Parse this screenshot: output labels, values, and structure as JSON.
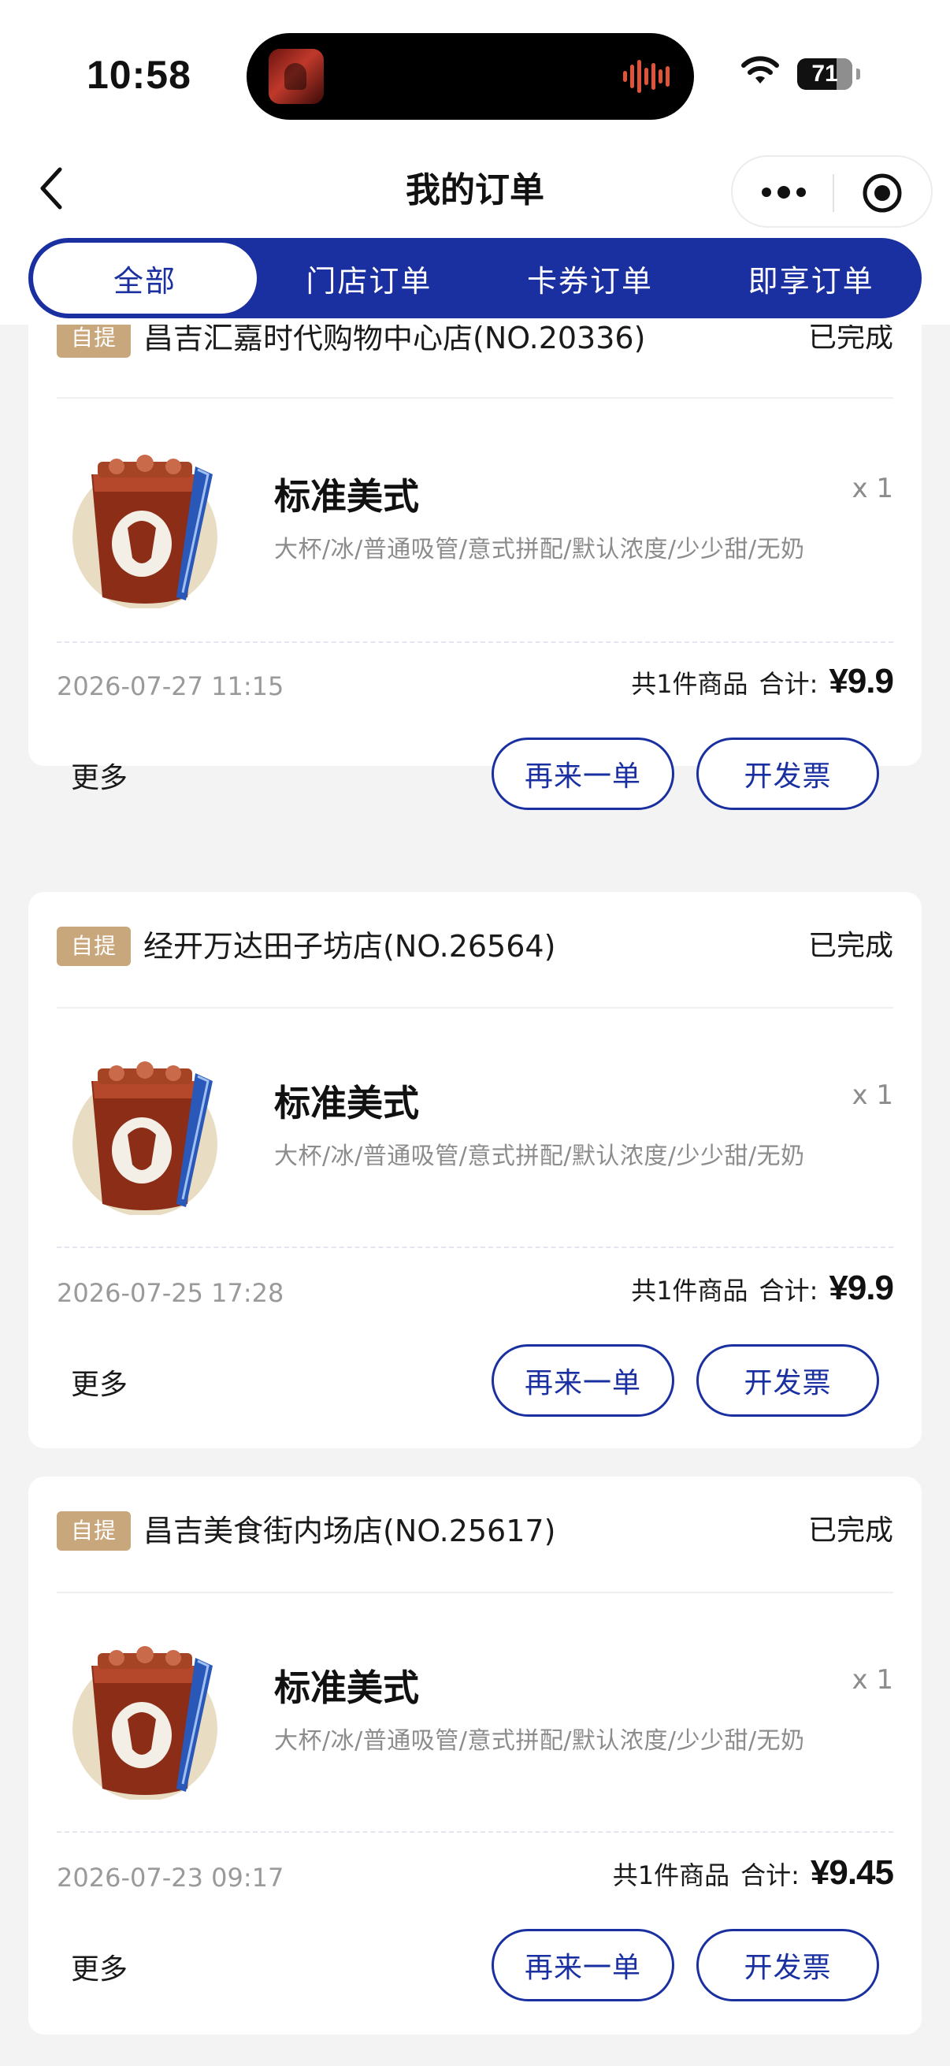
{
  "status_bar": {
    "time": "10:58",
    "battery": "71"
  },
  "nav": {
    "title": "我的订单"
  },
  "tabs": [
    {
      "label": "全部",
      "active": true
    },
    {
      "label": "门店订单",
      "active": false
    },
    {
      "label": "卡券订单",
      "active": false
    },
    {
      "label": "即享订单",
      "active": false
    }
  ],
  "orders": [
    {
      "tag": "自提",
      "store": "昌吉汇嘉时代购物中心店(NO.20336)",
      "status": "已完成",
      "product": {
        "name": "标准美式",
        "spec": "大杯/冰/普通吸管/意式拼配/默认浓度/少少甜/无奶",
        "qty": "x 1"
      },
      "time": "2026-07-27 11:15",
      "count_text": "共1件商品",
      "total_label": "合计:",
      "total": "¥9.9",
      "more": "更多",
      "reorder": "再来一单",
      "invoice": "开发票"
    },
    {
      "tag": "自提",
      "store": "经开万达田子坊店(NO.26564)",
      "status": "已完成",
      "product": {
        "name": "标准美式",
        "spec": "大杯/冰/普通吸管/意式拼配/默认浓度/少少甜/无奶",
        "qty": "x 1"
      },
      "time": "2026-07-25 17:28",
      "count_text": "共1件商品",
      "total_label": "合计:",
      "total": "¥9.9",
      "more": "更多",
      "reorder": "再来一单",
      "invoice": "开发票"
    },
    {
      "tag": "自提",
      "store": "昌吉美食街内场店(NO.25617)",
      "status": "已完成",
      "product": {
        "name": "标准美式",
        "spec": "大杯/冰/普通吸管/意式拼配/默认浓度/少少甜/无奶",
        "qty": "x 1"
      },
      "time": "2026-07-23 09:17",
      "count_text": "共1件商品",
      "total_label": "合计:",
      "total": "¥9.45",
      "more": "更多",
      "reorder": "再来一单",
      "invoice": "开发票"
    }
  ],
  "colors": {
    "brand_blue": "#1a2fa0",
    "tag_tan": "#c8a77c",
    "background": "#f3f3f3"
  },
  "icons": [
    "back-arrow-icon",
    "more-dots-icon",
    "target-icon",
    "wifi-icon",
    "battery-icon",
    "coffee-cup-icon"
  ]
}
